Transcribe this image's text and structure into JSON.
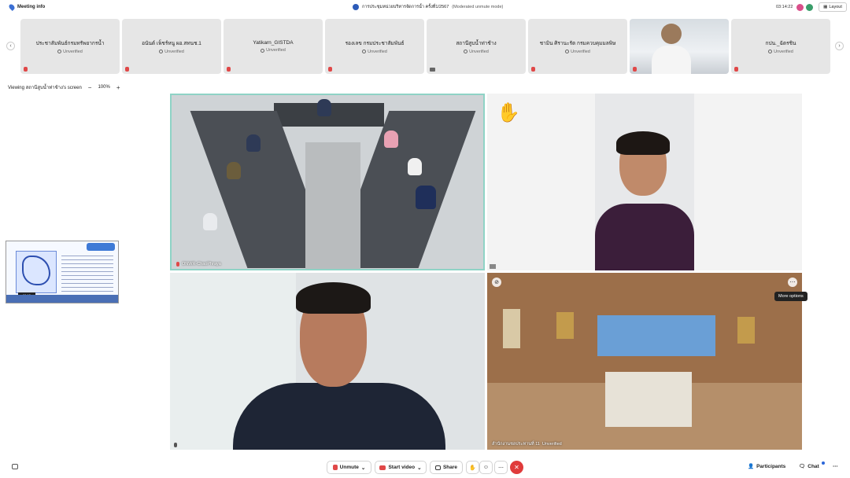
{
  "topbar": {
    "meeting_info": "Meeting info",
    "title": "การประชุมหน่วยบริหารจัดการน้ำ ครั้งที่1/2567",
    "mode": "(Moderated unmute mode)",
    "time": "03:14:22",
    "layout_label": "Layout"
  },
  "participants_strip": [
    {
      "name": "ประชาสัมพันธ์กรมทรัพยากรน้ำ",
      "status": "Unverified"
    },
    {
      "name": "อนันต์ เพ็ชร์หนู ผอ.สทนช.1",
      "status": "Unverified"
    },
    {
      "name": "Yatikarn_GISTDA",
      "status": "Unverified"
    },
    {
      "name": "รองเลข กรมประชาสัมพันธ์",
      "status": "Unverified"
    },
    {
      "name": "สถานีสูบน้ำท่าช้าง",
      "status": "Unverified"
    },
    {
      "name": "ชามิน ศิรานะรัต กรมควบคุมมลพิษ",
      "status": "Unverified"
    },
    {
      "name": "",
      "status": ""
    },
    {
      "name": "กปน._ฉัตรชิน",
      "status": "Unverified"
    }
  ],
  "viewing": {
    "label": "Viewing สถานีสูบน้ำท่าช้าง's screen",
    "zoom": "100%",
    "minus": "−",
    "plus": "+"
  },
  "videos": {
    "v1_name": "ONWR-ChaoPhraya",
    "v4_name": "สำนักงานชลประทานที่ 11",
    "v4_status": "Unverified",
    "tooltip": "More options",
    "screen_tag": "00:15"
  },
  "controls": {
    "unmute": "Unmute",
    "start_video": "Start video",
    "share": "Share",
    "participants": "Participants",
    "chat": "Chat"
  },
  "colors": {
    "accent": "#3b6fd4",
    "leave": "#e03b3b",
    "mic_muted": "#e04848"
  }
}
